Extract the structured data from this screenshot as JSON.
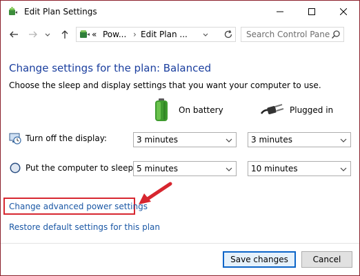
{
  "window": {
    "title": "Edit Plan Settings",
    "title_icon": "power-plan-icon",
    "controls": [
      "minimize-icon",
      "maximize-icon",
      "close-icon"
    ]
  },
  "nav": {
    "back_icon": "arrow-left-icon",
    "forward_icon": "arrow-right-icon",
    "recent_icon": "chevron-down-icon",
    "up_icon": "arrow-up-icon",
    "breadcrumb": {
      "overflow": "«",
      "items": [
        "Pow...",
        "Edit Plan ..."
      ],
      "separator": "›"
    },
    "refresh_icon": "refresh-icon",
    "search_placeholder": "Search Control Panel",
    "search_icon": "search-icon"
  },
  "content": {
    "heading": "Change settings for the plan: Balanced",
    "subtext": "Choose the sleep and display settings that you want your computer to use.",
    "columns": [
      {
        "label": "On battery",
        "icon": "battery-icon"
      },
      {
        "label": "Plugged in",
        "icon": "power-plug-icon"
      }
    ],
    "rows": [
      {
        "label": "Turn off the display:",
        "icon": "display-clock-icon",
        "on_battery": "3 minutes",
        "plugged_in": "3 minutes"
      },
      {
        "label": "Put the computer to sleep:",
        "icon": "sleep-moon-icon",
        "on_battery": "5 minutes",
        "plugged_in": "10 minutes"
      }
    ],
    "links": {
      "advanced": "Change advanced power settings",
      "restore": "Restore default settings for this plan"
    },
    "annotation_color": "#d7262f"
  },
  "buttons": {
    "save": "Save changes",
    "cancel": "Cancel"
  },
  "colors": {
    "heading": "#1a3e9e",
    "link": "#1a57a5",
    "window_border": "#8a1e2a",
    "default_button_border": "#0a64c8"
  }
}
